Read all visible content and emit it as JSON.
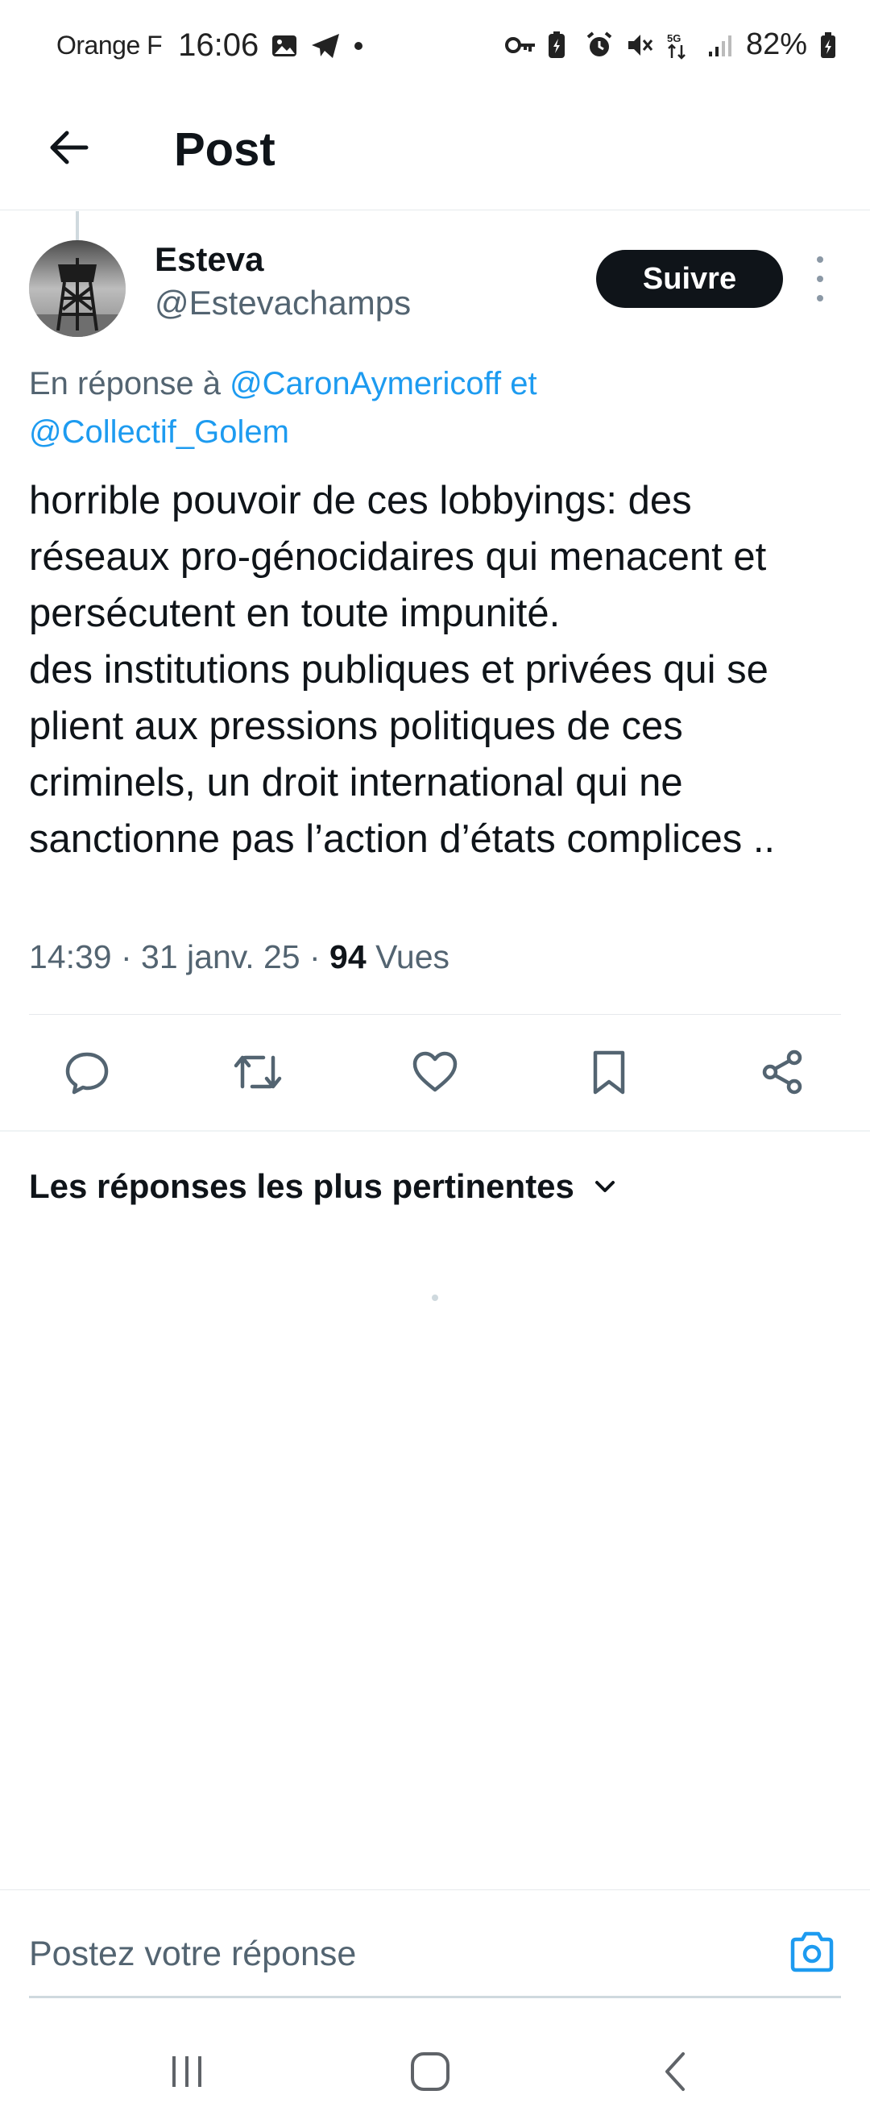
{
  "status_bar": {
    "carrier": "Orange F",
    "time": "16:06",
    "battery": "82%",
    "icons_left": [
      "image-icon",
      "telegram-icon",
      "notification-dot-icon"
    ],
    "icons_right": [
      "vpn-key-icon",
      "battery-saver-icon",
      "alarm-icon",
      "mute-icon",
      "5g-icon",
      "signal-icon",
      "battery-icon"
    ]
  },
  "header": {
    "title": "Post"
  },
  "post": {
    "author_name": "Esteva",
    "author_handle": "@Estevachamps",
    "follow_label": "Suivre",
    "reply_prefix": "En réponse à ",
    "reply_mention_1": "@CaronAymericoff",
    "reply_connector": " et",
    "reply_mention_2": "@Collectif_Golem",
    "text": "horrible pouvoir de ces lobbyings: des réseaux pro-génocidaires qui menacent et persécutent en toute impunité.\ndes institutions publiques et privées qui se plient aux pressions politiques de ces criminels, un droit international qui ne sanctionne pas l’action d’états complices ..",
    "time": "14:39",
    "date": "31 janv. 25",
    "views_count": "94",
    "views_label": "Vues"
  },
  "actions": [
    "reply-icon",
    "repost-icon",
    "like-icon",
    "bookmark-icon",
    "share-icon"
  ],
  "replies": {
    "sort_label": "Les réponses les plus pertinentes"
  },
  "composer": {
    "placeholder": "Postez votre réponse"
  },
  "colors": {
    "text": "#0f1419",
    "secondary": "#536471",
    "accent": "#1d9bf0",
    "follow_bg": "#0f1419",
    "divider": "#e6e9ec"
  }
}
